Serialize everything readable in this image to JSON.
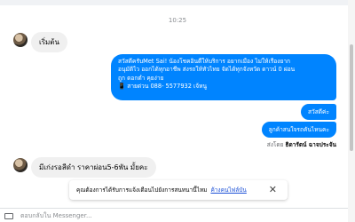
{
  "chat": {
    "timestamp": "10:25",
    "messages_in": [
      {
        "text": "เริ่มต้น"
      },
      {
        "text": "มีเก่งรอสีดำ ราคาผ่อน5-6พัน มั้ยคะ"
      }
    ],
    "message_out_multi": [
      "สวัสดีครับMet Sai! น้องโชคอินดี้ให้บริการ อยากเมือง ไม่ให้เรื่องยาก",
      "อนุมัติไว ออกได้ทุกอาชีพ ส่งรถให้ทั่วไทย จัดได้ทุกจังหวัด ดาวน์ 0 ผ่อน",
      "ถูก ดอกต่ำ คุยง่าย",
      "📱 สายด่วน 088- 5577932 เจ้หนู"
    ],
    "message_out_2": "สวัสดีค่ะ",
    "message_out_3": "ลูกค้าสนใจรถคันไหนคะ",
    "sent_by_prefix": "ส่งโดย",
    "sent_by_name": "ธิดารัตน์ ฉาจประจัน",
    "icon_compose": "keyboard-icon",
    "icon_close": "close-icon"
  },
  "notice": {
    "text": "คุณต้องการได้รับการแจ้งเตือนไปยังการสนทนานี้ไหม",
    "link": "ค้างคนไฟล์บัน",
    "close": "✕"
  },
  "composer": {
    "placeholder": "ตอบกลับใน Messenger..."
  },
  "colors": {
    "accent": "#0084ff",
    "incoming": "#f0f0f0",
    "link": "#1a4fd6"
  }
}
